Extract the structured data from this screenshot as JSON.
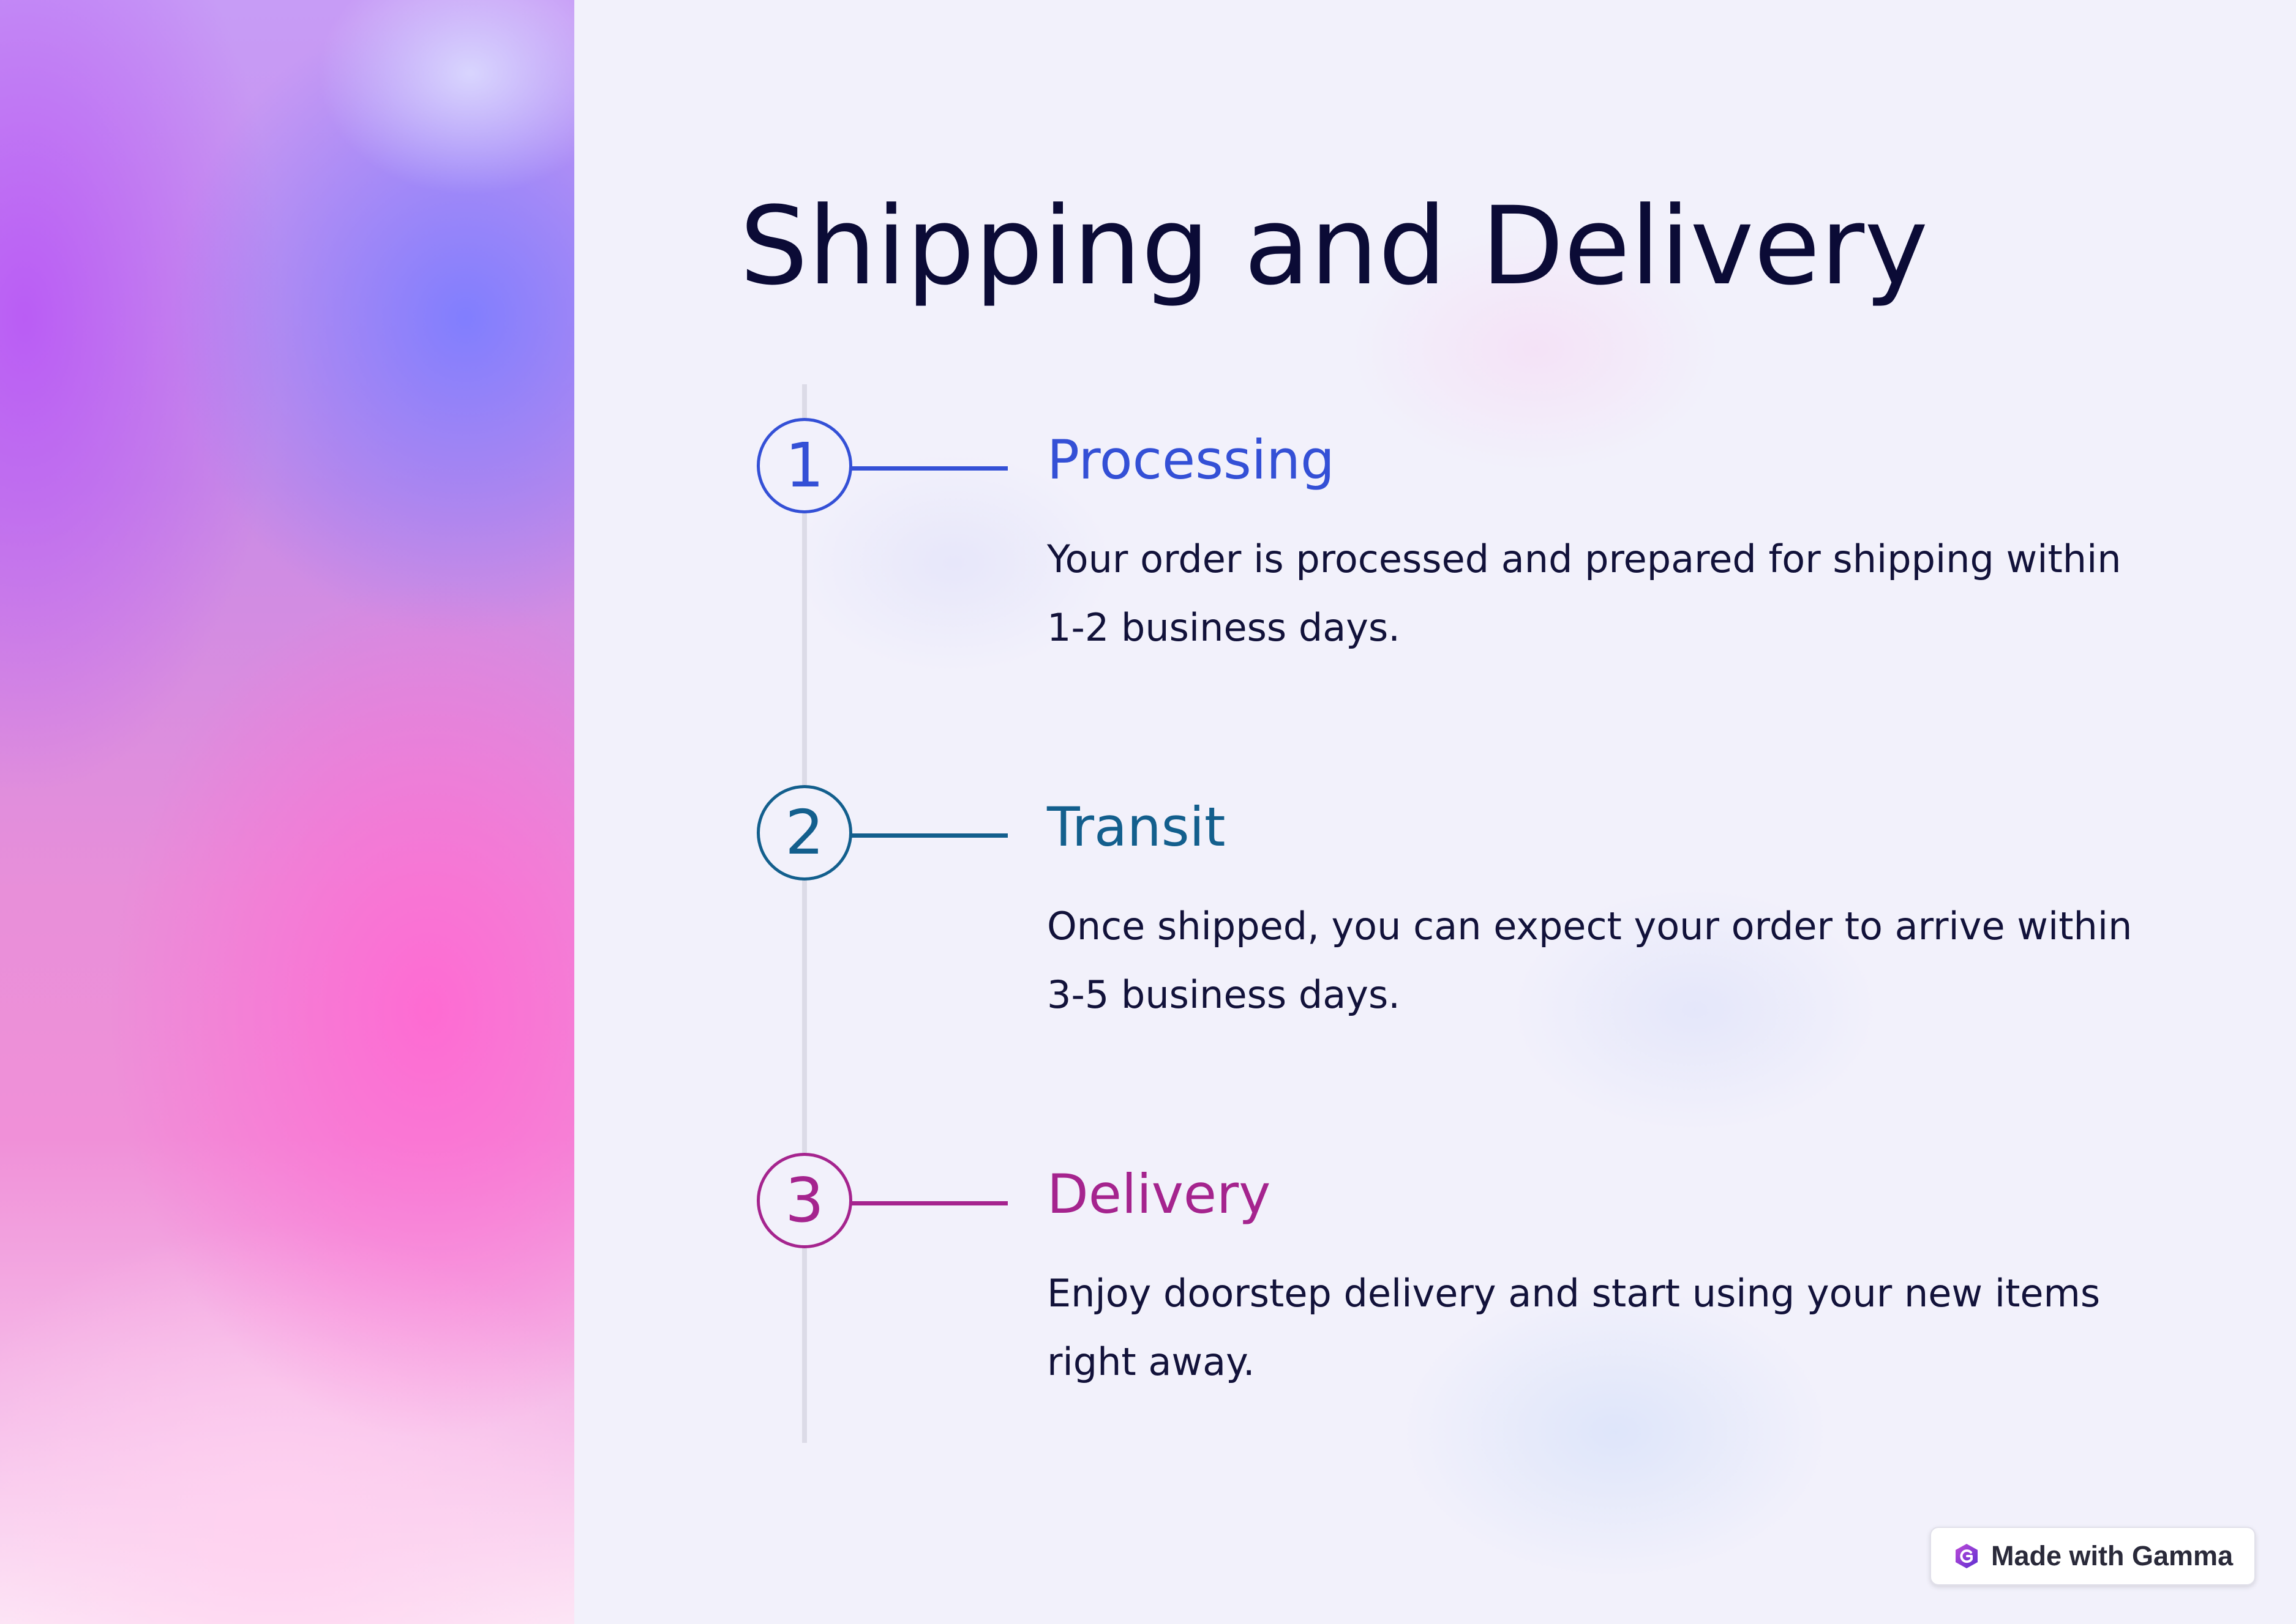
{
  "slide": {
    "title": "Shipping and Delivery"
  },
  "steps": [
    {
      "number": "1",
      "heading": "Processing",
      "text": "Your order is processed and prepared for shipping within 1-2 business days.",
      "color": "#3450d6"
    },
    {
      "number": "2",
      "heading": "Transit",
      "text": "Once shipped, you can expect your order to arrive within 3-5 business days.",
      "color": "#135f8d"
    },
    {
      "number": "3",
      "heading": "Delivery",
      "text": "Enjoy doorstep delivery and start using your new items right away.",
      "color": "#a5248e"
    }
  ],
  "badge": {
    "label": "Made with Gamma",
    "icon": "gamma-logo-icon"
  }
}
